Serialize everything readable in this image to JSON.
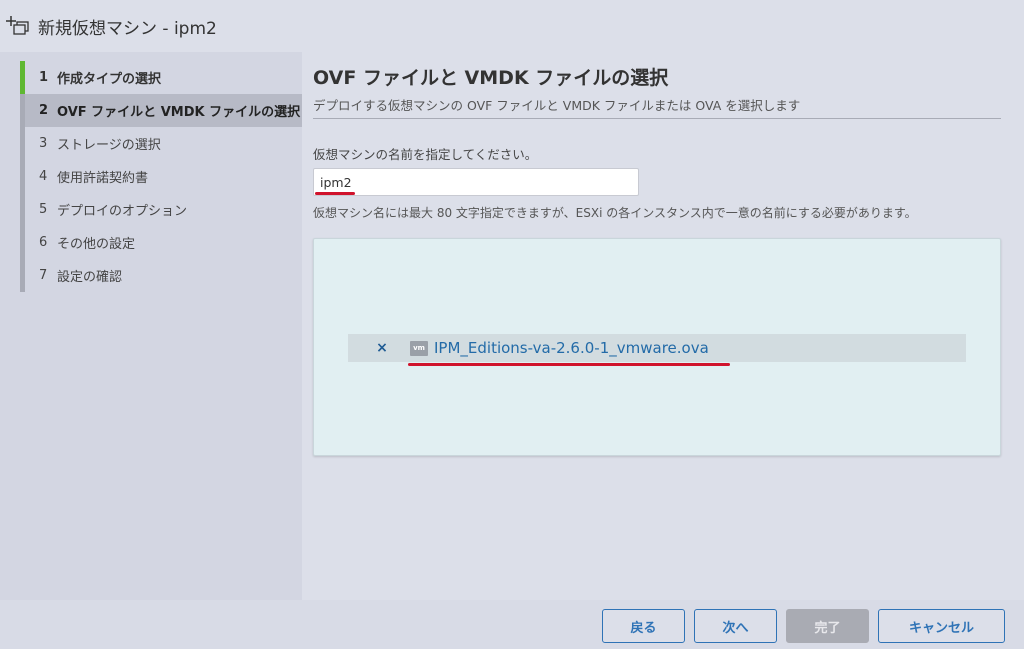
{
  "window": {
    "title": "新規仮想マシン - ipm2"
  },
  "steps": [
    {
      "num": "1",
      "label": "作成タイプの選択"
    },
    {
      "num": "2",
      "label": "OVF ファイルと VMDK ファイルの選択"
    },
    {
      "num": "3",
      "label": "ストレージの選択"
    },
    {
      "num": "4",
      "label": "使用許諾契約書"
    },
    {
      "num": "5",
      "label": "デプロイのオプション"
    },
    {
      "num": "6",
      "label": "その他の設定"
    },
    {
      "num": "7",
      "label": "設定の確認"
    }
  ],
  "main": {
    "title": "OVF ファイルと VMDK ファイルの選択",
    "subtitle": "デプロイする仮想マシンの OVF ファイルと VMDK ファイルまたは OVA を選択します",
    "name_label": "仮想マシンの名前を指定してください。",
    "name_value": "ipm2",
    "hint": "仮想マシン名には最大 80 文字指定できますが、ESXi の各インスタンス内で一意の名前にする必要があります。",
    "file": {
      "remove_glyph": "×",
      "icon_text": "vm",
      "name": "IPM_Editions-va-2.6.0-1_vmware.ova"
    }
  },
  "footer": {
    "back": "戻る",
    "next": "次へ",
    "finish": "完了",
    "cancel": "キャンセル"
  },
  "colors": {
    "progress_done": "#5fb832",
    "accent_blue": "#2f73b6",
    "highlight_red": "#d0132c"
  }
}
